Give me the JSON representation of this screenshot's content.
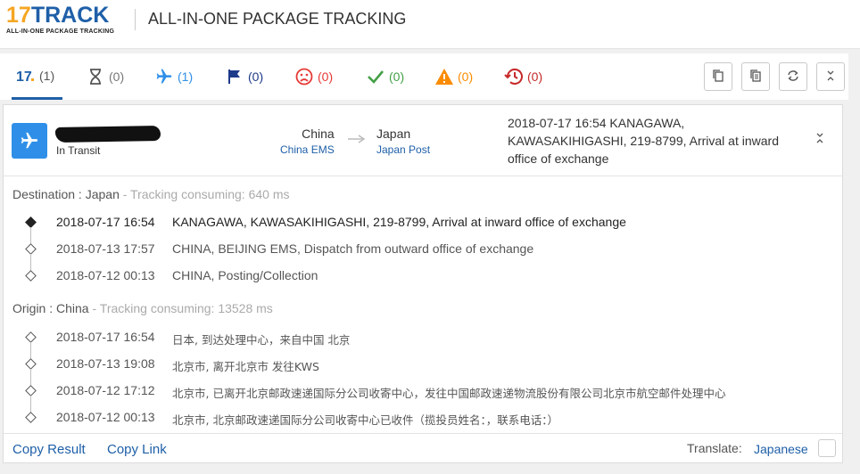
{
  "header": {
    "logo_number": "17",
    "logo_word": "TRACK",
    "logo_tagline": "ALL-IN-ONE PACKAGE TRACKING",
    "title": "ALL-IN-ONE PACKAGE TRACKING"
  },
  "tabs": [
    {
      "icon": "17track-logo-icon",
      "count": "(1)",
      "color": "#1e5fa8"
    },
    {
      "icon": "hourglass-icon",
      "count": "(0)",
      "color": "#555555"
    },
    {
      "icon": "airplane-icon",
      "count": "(1)",
      "color": "#2f8fe8"
    },
    {
      "icon": "flag-icon",
      "count": "(0)",
      "color": "#1e3a8a"
    },
    {
      "icon": "sad-face-icon",
      "count": "(0)",
      "color": "#e53935"
    },
    {
      "icon": "checkmark-icon",
      "count": "(0)",
      "color": "#43a047"
    },
    {
      "icon": "warning-icon",
      "count": "(0)",
      "color": "#fb8c00"
    },
    {
      "icon": "history-clock-icon",
      "count": "(0)",
      "color": "#c62828"
    }
  ],
  "toolbar": {
    "buttons": [
      "copy-icon",
      "copy-all-icon",
      "refresh-icon",
      "collapse-icon"
    ]
  },
  "package": {
    "status": "In Transit",
    "origin_country": "China",
    "origin_carrier": "China EMS",
    "dest_country": "Japan",
    "dest_carrier": "Japan Post",
    "latest_event": "2018-07-17 16:54 KANAGAWA, KAWASAKIHIGASHI, 219-8799, Arrival at inward office of exchange"
  },
  "destination": {
    "label": "Destination : Japan",
    "consuming": " - Tracking consuming: 640 ms",
    "events": [
      {
        "time": "2018-07-17 16:54",
        "desc": "KANAGAWA, KAWASAKIHIGASHI, 219-8799, Arrival at inward office of exchange"
      },
      {
        "time": "2018-07-13 17:57",
        "desc": "CHINA, BEIJING EMS, Dispatch from outward office of exchange"
      },
      {
        "time": "2018-07-12 00:13",
        "desc": "CHINA, Posting/Collection"
      }
    ]
  },
  "origin": {
    "label": "Origin : China",
    "consuming": " - Tracking consuming: 13528 ms",
    "events": [
      {
        "time": "2018-07-17 16:54",
        "desc": "日本, 到达处理中心，来自中国 北京"
      },
      {
        "time": "2018-07-13 19:08",
        "desc": "北京市, 离开北京市 发往KWS"
      },
      {
        "time": "2018-07-12 17:12",
        "desc": "北京市, 已离开北京邮政速递国际分公司收寄中心，发往中国邮政速递物流股份有限公司北京市航空邮件处理中心"
      },
      {
        "time": "2018-07-12 00:13",
        "desc": "北京市, 北京邮政速递国际分公司收寄中心已收件（揽投员姓名：，联系电话：）"
      }
    ]
  },
  "footer": {
    "copy_result": "Copy Result",
    "copy_link": "Copy Link",
    "translate_label": "Translate:",
    "translate_value": "Japanese"
  }
}
